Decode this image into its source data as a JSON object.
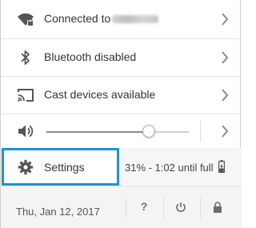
{
  "network": {
    "label": "Connected to",
    "ssid_hidden": true
  },
  "bluetooth": {
    "label": "Bluetooth disabled"
  },
  "cast": {
    "label": "Cast devices available"
  },
  "volume": {
    "level_fraction": 0.72
  },
  "settings": {
    "label": "Settings"
  },
  "battery": {
    "status": "31% - 1:02 until full",
    "percent": 31
  },
  "footer": {
    "date": "Thu, Jan 12, 2017",
    "help_glyph": "?"
  },
  "colors": {
    "highlight": "#1b93d6",
    "icon": "#555555"
  }
}
